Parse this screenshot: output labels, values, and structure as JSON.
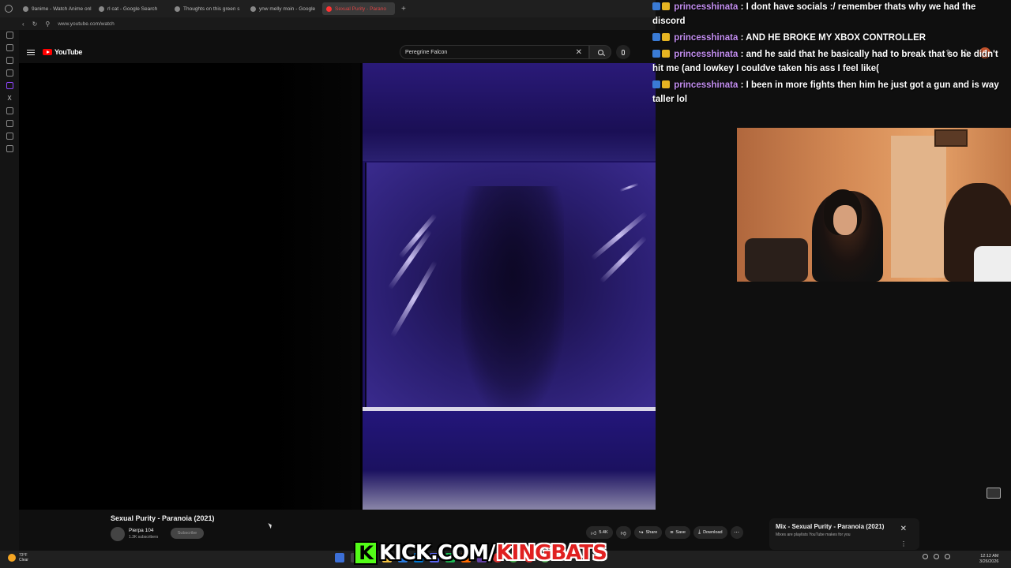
{
  "browser": {
    "tabs": [
      {
        "label": "9anime - Watch Anime onl",
        "active": false
      },
      {
        "label": "rl cat - Google Search",
        "active": false
      },
      {
        "label": "Thoughts on this green s",
        "active": false
      },
      {
        "label": "ynw melly moin - Google",
        "active": false
      },
      {
        "label": "Sexual Purity - Parano",
        "active": true
      }
    ],
    "new_tab": "+",
    "url": "www.youtube.com/watch"
  },
  "youtube": {
    "logo_text": "YouTube",
    "search_query": "Peregrine Falcon",
    "clear_glyph": "✕",
    "profile_initial": "G"
  },
  "video": {
    "title": "Sexual Purity - Paranoia (2021)",
    "channel": "Pierpa 104",
    "subscribers": "1.3K subscribers",
    "subscribe_label": "Subscribe",
    "likes": "5.4K",
    "share_label": "Share",
    "save_label": "Save",
    "download_label": "Download"
  },
  "mix": {
    "title": "Mix - Sexual Purity - Paranoia (2021)",
    "subtitle": "Mixes are playlists YouTube makes for you"
  },
  "chat": [
    {
      "user": "princesshinata",
      "message": "I dont have socials :/ remember thats why we had the discord"
    },
    {
      "user": "princesshinata",
      "message": "AND HE BROKE MY XBOX CONTROLLER"
    },
    {
      "user": "princesshinata",
      "message": "and he said that he basically had to break that so he didn't hit me (and lowkey I couldve taken his ass I feel like("
    },
    {
      "user": "princesshinata",
      "message": "I been in more fights then him he just got a gun and is way taller lol"
    }
  ],
  "overlay": {
    "kick_letter": "K",
    "kick_domain": "KICK.COM/",
    "kick_name": "KINGBATS"
  },
  "taskbar": {
    "weather_temp": "73°F",
    "weather_desc": "Clear",
    "time": "12:12 AM",
    "date": "3/26/2026"
  },
  "colors": {
    "accent_red": "#ff0000",
    "chat_username": "#c38ef0",
    "kick_green": "#53fc18"
  }
}
